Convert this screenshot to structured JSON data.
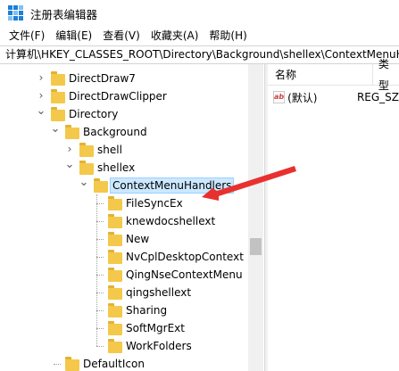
{
  "window": {
    "title": "注册表编辑器",
    "icon": "registry-editor-icon"
  },
  "menu": {
    "items": [
      "文件(F)",
      "编辑(E)",
      "查看(V)",
      "收藏夹(A)",
      "帮助(H)"
    ]
  },
  "address": "计算机\\HKEY_CLASSES_ROOT\\Directory\\Background\\shellex\\ContextMenuHandlers",
  "tree": {
    "nodes": [
      {
        "label": "DirectDraw7",
        "expander": "collapsed"
      },
      {
        "label": "DirectDrawClipper",
        "expander": "collapsed"
      },
      {
        "label": "Directory",
        "expander": "expanded"
      },
      {
        "label": "Background",
        "expander": "expanded"
      },
      {
        "label": "shell",
        "expander": "collapsed"
      },
      {
        "label": "shellex",
        "expander": "expanded"
      },
      {
        "label": "ContextMenuHandlers",
        "expander": "expanded",
        "selected": true
      },
      {
        "label": "FileSyncEx",
        "expander": "none"
      },
      {
        "label": "knewdocshellext",
        "expander": "none"
      },
      {
        "label": "New",
        "expander": "none"
      },
      {
        "label": "NvCplDesktopContext",
        "expander": "none"
      },
      {
        "label": "QingNseContextMenu",
        "expander": "none"
      },
      {
        "label": "qingshellext",
        "expander": "none"
      },
      {
        "label": "Sharing",
        "expander": "none"
      },
      {
        "label": "SoftMgrExt",
        "expander": "none"
      },
      {
        "label": "WorkFolders",
        "expander": "none"
      },
      {
        "label": "DefaultIcon",
        "expander": "none"
      }
    ]
  },
  "list": {
    "columns": {
      "name": "名称",
      "type": "类型"
    },
    "rows": [
      {
        "name": "(默认)",
        "type": "REG_SZ",
        "icon": "string-value-icon",
        "icon_text": "ab"
      }
    ]
  },
  "colors": {
    "folder": "#f4c84a",
    "selection": "#cce8ff",
    "arrow": "#e8312f"
  }
}
